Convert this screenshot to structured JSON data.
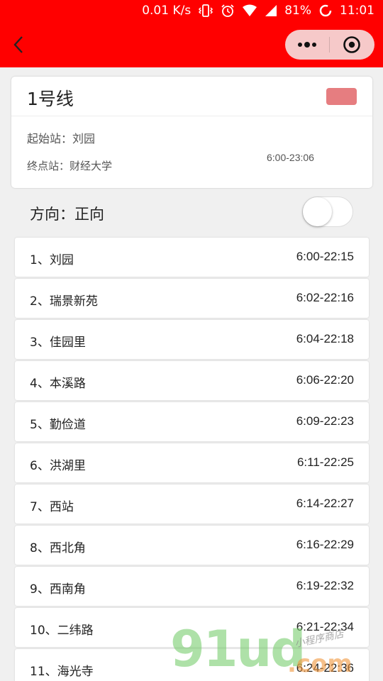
{
  "status_bar": {
    "speed": "0.01 K/s",
    "battery": "81%",
    "time": "11:01"
  },
  "colors": {
    "header": "#ff0000",
    "line_color": "#e67d80"
  },
  "line": {
    "name": "1号线",
    "start_label": "起始站：刘园",
    "end_label": "终点站：财经大学",
    "hours": "6:00-23:06"
  },
  "direction": {
    "label": "方向：正向",
    "toggle_on": false
  },
  "stations": [
    {
      "name": "1、刘园",
      "time": "6:00-22:15"
    },
    {
      "name": "2、瑞景新苑",
      "time": "6:02-22:16"
    },
    {
      "name": "3、佳园里",
      "time": "6:04-22:18"
    },
    {
      "name": "4、本溪路",
      "time": "6:06-22:20"
    },
    {
      "name": "5、勤俭道",
      "time": "6:09-22:23"
    },
    {
      "name": "6、洪湖里",
      "time": "6:11-22:25"
    },
    {
      "name": "7、西站",
      "time": "6:14-22:27"
    },
    {
      "name": "8、西北角",
      "time": "6:16-22:29"
    },
    {
      "name": "9、西南角",
      "time": "6:19-22:32"
    },
    {
      "name": "10、二纬路",
      "time": "6:21-22:34"
    },
    {
      "name": "11、海光寺",
      "time": "6:24-22:36"
    }
  ],
  "watermark": {
    "main": "91ud",
    "suffix": ".com",
    "tag": "小程序商店"
  },
  "icons": {
    "back": "chevron-left-icon",
    "more": "more-dots-icon",
    "close": "target-close-icon"
  }
}
